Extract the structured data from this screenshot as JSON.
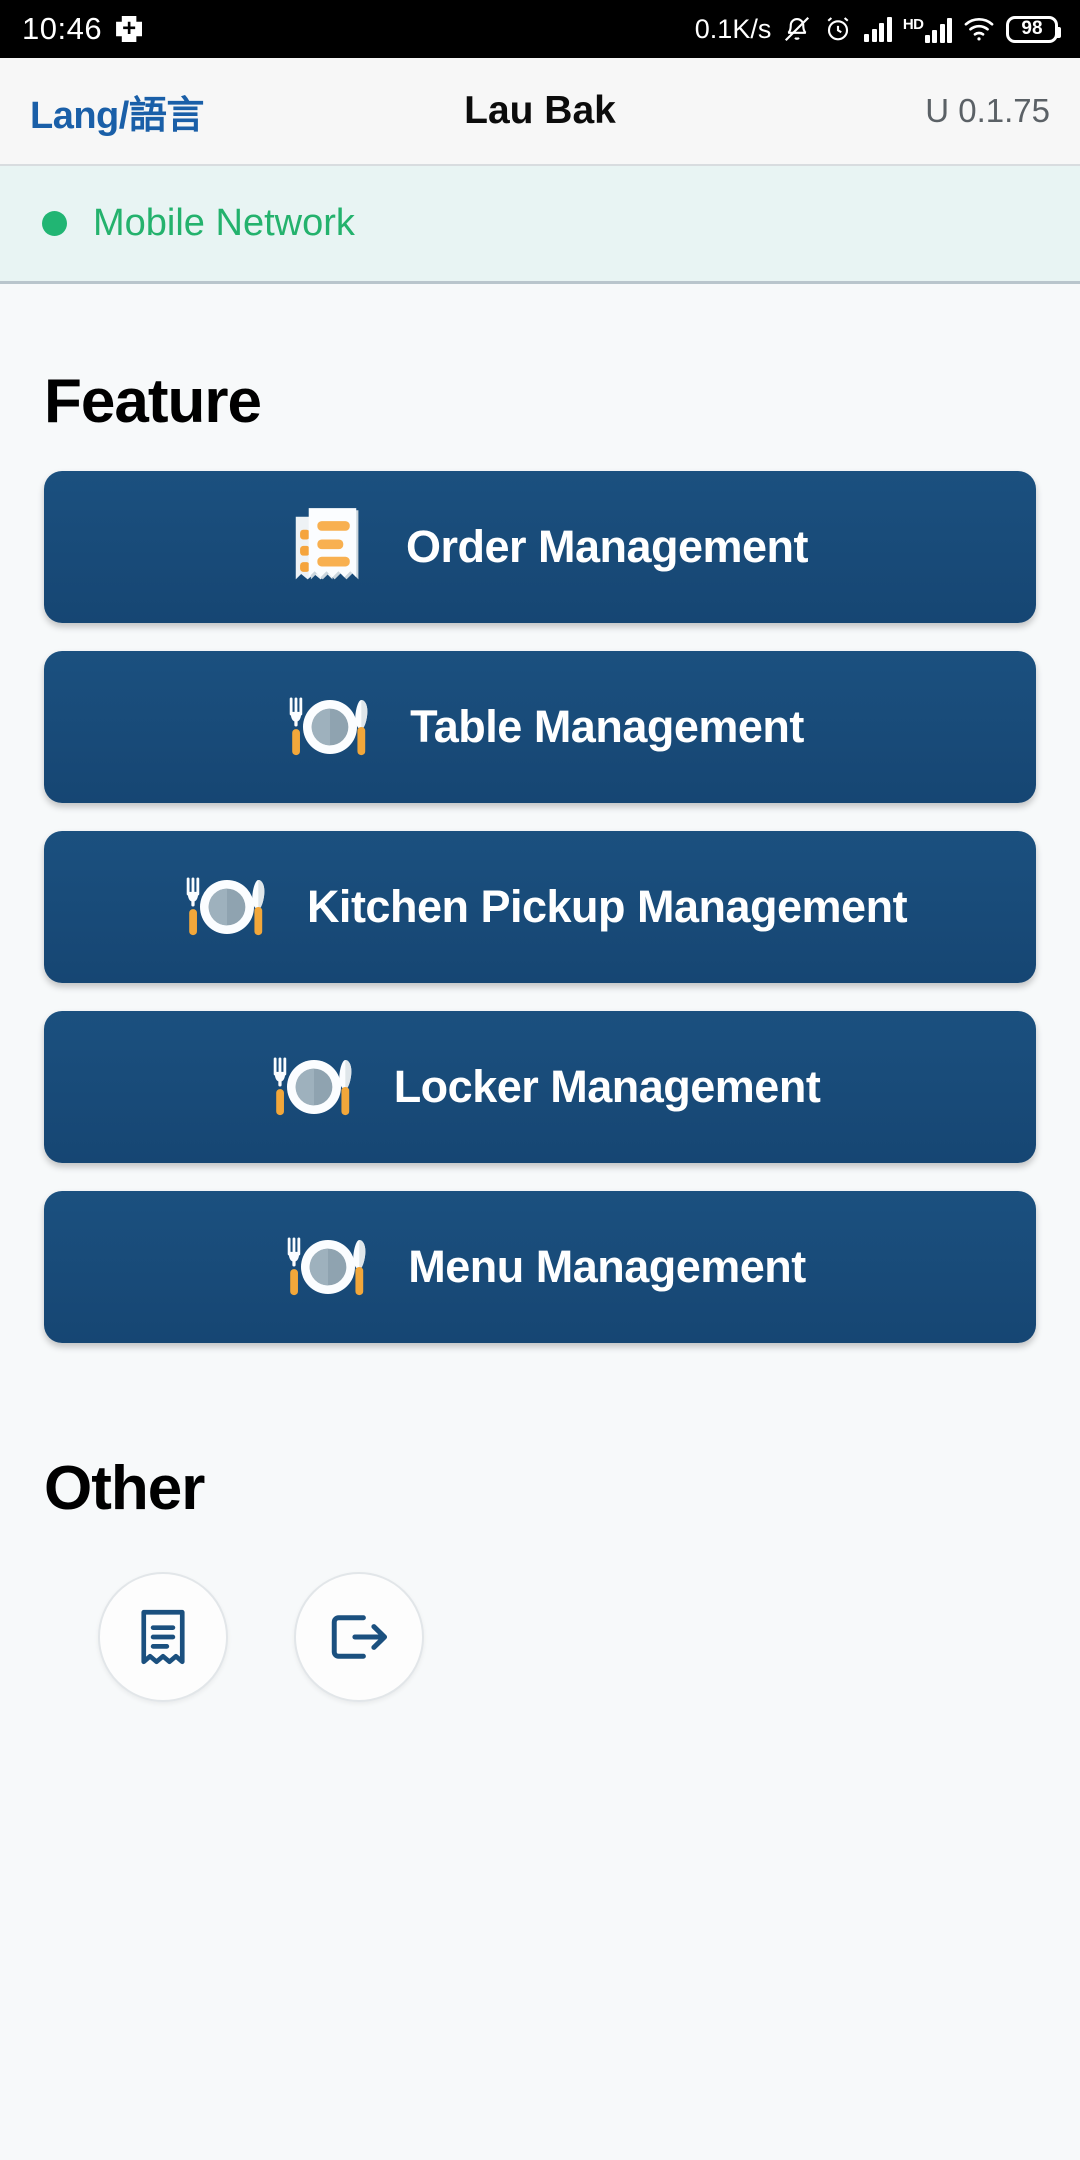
{
  "statusbar": {
    "time": "10:46",
    "plus_icon": "medical-plus-icon",
    "network_speed": "0.1K/s",
    "mute_icon": "bell-muted-icon",
    "alarm_icon": "alarm-clock-icon",
    "signal1_icon": "signal-bars-icon",
    "hd_label": "HD",
    "signal2_icon": "signal-bars-icon",
    "wifi_icon": "wifi-icon",
    "battery_level": "98"
  },
  "appbar": {
    "lang_label": "Lang/語言",
    "title": "Lau Bak",
    "version": "U 0.1.75"
  },
  "network_banner": {
    "status_label": "Mobile Network",
    "dot_color": "#21b573",
    "text_color": "#24b26d",
    "background": "#e8f4f3"
  },
  "sections": [
    {
      "heading": "Feature",
      "cards": [
        {
          "label": "Order Management",
          "icon": "receipt-icon"
        },
        {
          "label": "Table Management",
          "icon": "cutlery-plate-icon"
        },
        {
          "label": "Kitchen Pickup Management",
          "icon": "cutlery-plate-icon"
        },
        {
          "label": "Locker Management",
          "icon": "cutlery-plate-icon"
        },
        {
          "label": "Menu Management",
          "icon": "cutlery-plate-icon"
        }
      ]
    },
    {
      "heading": "Other",
      "buttons": [
        {
          "icon": "receipt-outline-icon"
        },
        {
          "icon": "logout-icon"
        }
      ]
    }
  ],
  "colors": {
    "card_blue": "#1b507f",
    "accent_orange": "#f5a43c",
    "page_background": "#f7f9fa",
    "link_blue": "#1a5fa8"
  }
}
